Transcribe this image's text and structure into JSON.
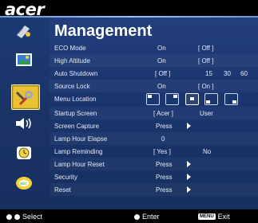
{
  "brand": "acer",
  "title": "Management",
  "rows": [
    {
      "label": "ECO Mode",
      "c1": "On",
      "c2": "[ Off ]"
    },
    {
      "label": "High Altitude",
      "c1": "On",
      "c2": "[ Off ]"
    },
    {
      "label": "Auto Shutdown",
      "c1": "[ Off ]",
      "c2": "15",
      "c3": "30",
      "c4": "60"
    },
    {
      "label": "Source Lock",
      "c1": "On",
      "c2": "[ On ]"
    },
    {
      "label": "Menu Location"
    },
    {
      "label": "Startup Screen",
      "c1": "[ Acer ]",
      "c2": "User"
    },
    {
      "label": "Screen Capture",
      "c1": "Press"
    },
    {
      "label": "Lamp Hour Elapse",
      "c1": "0"
    },
    {
      "label": "Lamp Reminding",
      "c1": "[ Yes ]",
      "c2": "No"
    },
    {
      "label": "Lamp Hour Reset",
      "c1": "Press"
    },
    {
      "label": "Security",
      "c1": "Press"
    },
    {
      "label": "Reset",
      "c1": "Press"
    }
  ],
  "footer": {
    "select_label": "Select",
    "enter_label": "Enter",
    "menu_key": "MENU",
    "exit_label": "Exit"
  },
  "colors": {
    "active_icon": "#e8c233",
    "panel": "#1b3570"
  }
}
